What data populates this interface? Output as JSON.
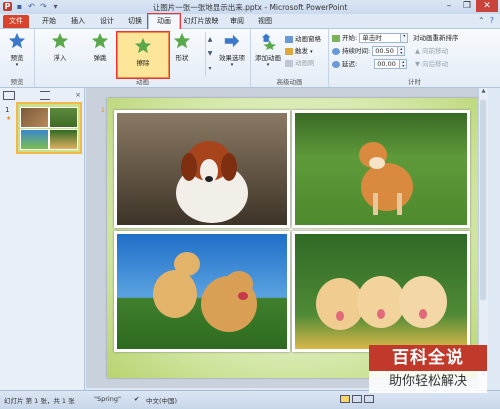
{
  "window": {
    "title": "让图片一张一张地显示出来.pptx - Microsoft PowerPoint",
    "app_icon_letter": "P"
  },
  "tabs": [
    {
      "label": "文件",
      "state": "file"
    },
    {
      "label": "开始"
    },
    {
      "label": "插入"
    },
    {
      "label": "设计"
    },
    {
      "label": "切换"
    },
    {
      "label": "动画",
      "state": "active"
    },
    {
      "label": "幻灯片放映"
    },
    {
      "label": "审阅"
    },
    {
      "label": "视图"
    }
  ],
  "ribbon": {
    "preview": {
      "label": "预览",
      "group": "预览"
    },
    "animations": {
      "group": "动画",
      "items": [
        "浮入",
        "弹跳",
        "擦除",
        "形状"
      ],
      "selected": "擦除",
      "effect_options": "效果选项"
    },
    "advanced": {
      "group": "高级动画",
      "add_animation": "添加动画",
      "pane": "动画窗格",
      "trigger": "触发",
      "painter": "动画刷"
    },
    "timing": {
      "group": "计时",
      "start_label": "开始:",
      "start_value": "单击时",
      "duration_label": "持续时间:",
      "duration_value": "00.50",
      "delay_label": "延迟:",
      "delay_value": "00.00",
      "reorder_title": "对动画重新排序",
      "move_earlier": "向前移动",
      "move_later": "向后移动"
    }
  },
  "left_panel": {
    "slide_number": "1",
    "close": "×"
  },
  "status": {
    "slide_info": "幻灯片 第 1 张，共 1 张",
    "theme": "\"Spring\"",
    "language": "中文(中国)"
  },
  "watermark": {
    "line1": "百科全说",
    "line2": "助你轻松解决"
  },
  "colors": {
    "file_tab": "#d8432c",
    "highlight": "#e33333",
    "selected_effect_bg": "#fde59a"
  }
}
